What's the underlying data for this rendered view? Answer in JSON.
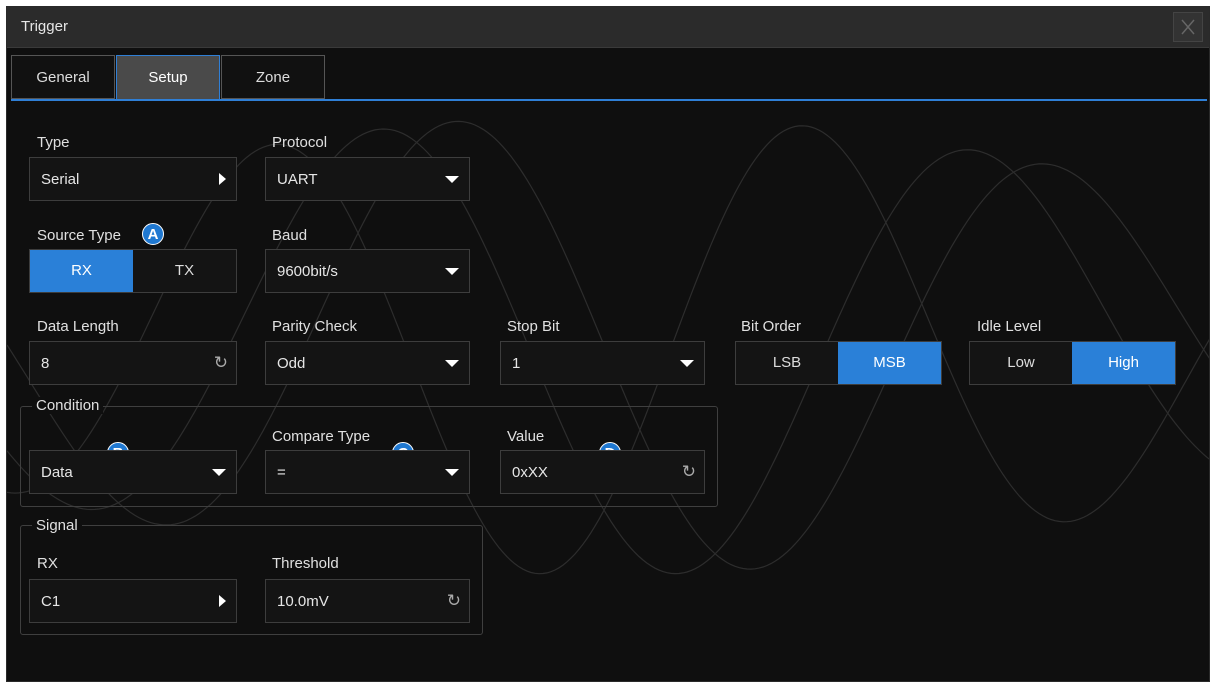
{
  "window": {
    "title": "Trigger"
  },
  "tabs": [
    "General",
    "Setup",
    "Zone"
  ],
  "active_tab": "Setup",
  "labels": {
    "type": "Type",
    "protocol": "Protocol",
    "source_type": "Source Type",
    "baud": "Baud",
    "data_length": "Data Length",
    "parity_check": "Parity Check",
    "stop_bit": "Stop Bit",
    "bit_order": "Bit Order",
    "idle_level": "Idle Level",
    "condition": "Condition",
    "compare_type": "Compare Type",
    "value": "Value",
    "signal": "Signal",
    "rx": "RX",
    "threshold": "Threshold"
  },
  "values": {
    "type": "Serial",
    "protocol": "UART",
    "baud": "9600bit/s",
    "data_length": "8",
    "parity_check": "Odd",
    "stop_bit": "1",
    "condition": "Data",
    "compare_type": "=",
    "value": "0xXX",
    "rx_source": "C1",
    "threshold": "10.0mV"
  },
  "source_type": {
    "options": [
      "RX",
      "TX"
    ],
    "selected": "RX"
  },
  "bit_order": {
    "options": [
      "LSB",
      "MSB"
    ],
    "selected": "MSB"
  },
  "idle_level": {
    "options": [
      "Low",
      "High"
    ],
    "selected": "High"
  },
  "badges": [
    "A",
    "B",
    "C",
    "D"
  ],
  "colors": {
    "accent": "#2a80d8",
    "badge": "#1f78d1",
    "background": "#0f0f0f"
  },
  "icons": {
    "close": "close-icon",
    "submenu": "triangle-right-icon",
    "dropdown": "triangle-down-icon",
    "adjust": "refresh-knob-icon"
  }
}
